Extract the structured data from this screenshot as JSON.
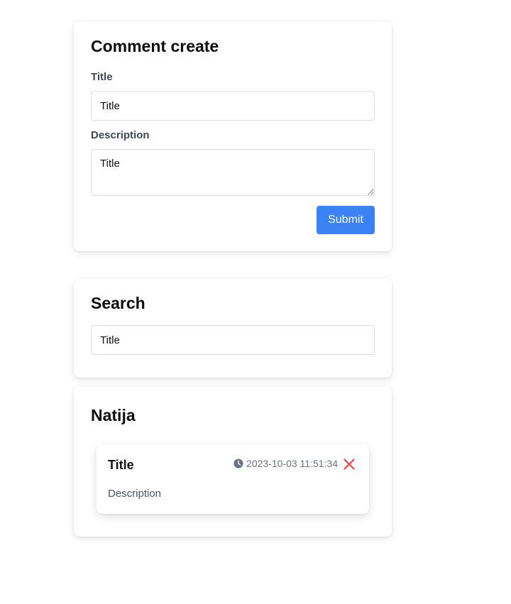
{
  "create_form": {
    "title": "Comment create",
    "title_label": "Title",
    "title_value": "Title",
    "description_label": "Description",
    "description_value": "Title",
    "submit_label": "Submit"
  },
  "search": {
    "title": "Search",
    "value": "Title"
  },
  "results": {
    "title": "Natija",
    "comments": [
      {
        "title": "Title",
        "timestamp": "2023-10-03 11:51:34",
        "description": "Description"
      }
    ]
  },
  "colors": {
    "accent": "#3b82f6",
    "delete": "#ef4444",
    "muted": "#6b7280"
  },
  "icons": {
    "timestamp": "clock-icon",
    "delete": "close-icon"
  }
}
